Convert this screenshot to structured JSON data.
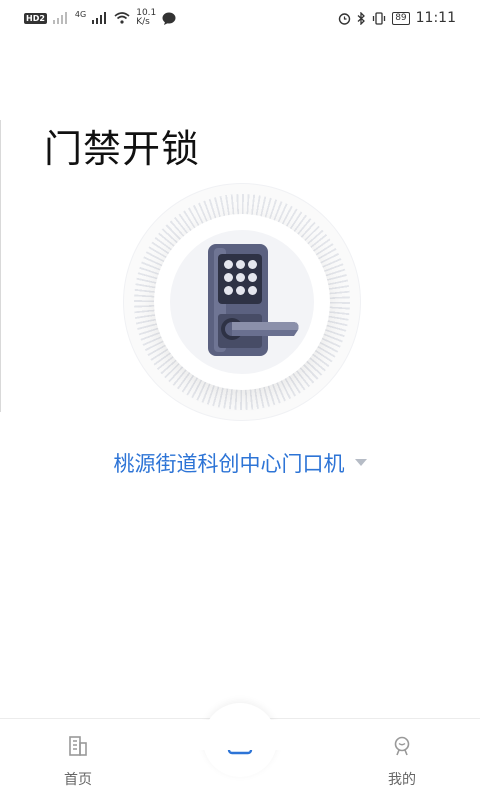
{
  "status_bar": {
    "network_badge": "HD",
    "network_sub": "2",
    "signal_label": "4G",
    "speed_value": "10.1",
    "speed_unit": "K/s",
    "battery": "89",
    "time": "11:11"
  },
  "page_title": "门禁开锁",
  "device": {
    "name": "桃源街道科创中心门口机"
  },
  "bottom_nav": {
    "home_label": "首页",
    "mine_label": "我的"
  },
  "colors": {
    "accent": "#2d74d6",
    "lock_body": "#5b6180",
    "lock_dark": "#2e3245"
  },
  "icons": {
    "home": "building-icon",
    "center": "unlock-icon",
    "mine": "user-icon"
  }
}
